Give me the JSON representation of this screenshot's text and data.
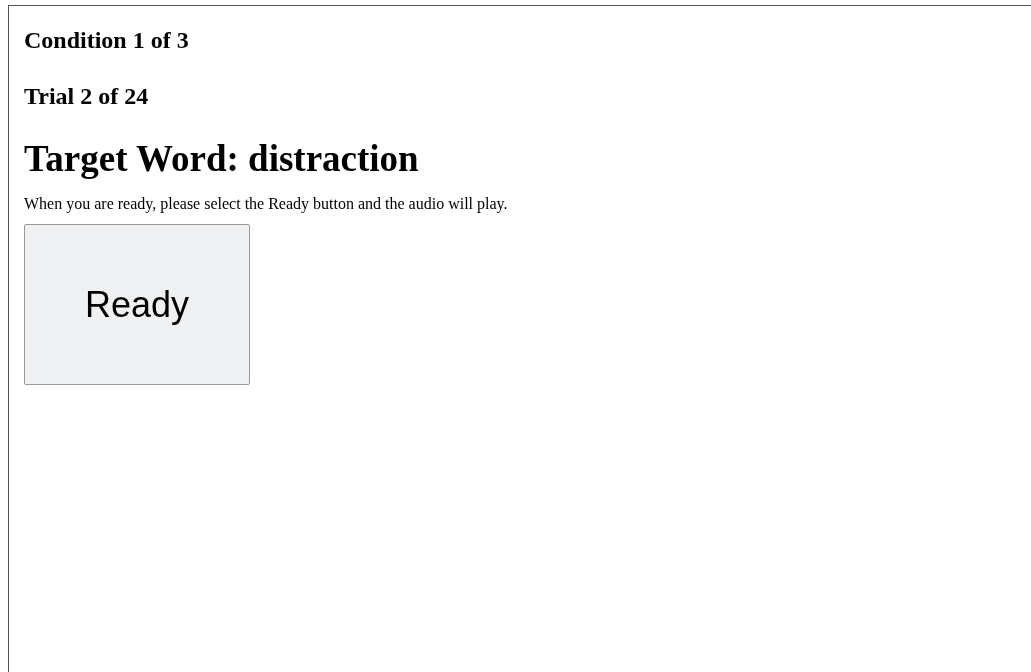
{
  "condition": "Condition 1 of 3",
  "trial": "Trial 2 of 24",
  "target": "Target Word: distraction",
  "instructions": "When you are ready, please select the Ready button and the audio will play.",
  "button": {
    "label": "Ready"
  }
}
